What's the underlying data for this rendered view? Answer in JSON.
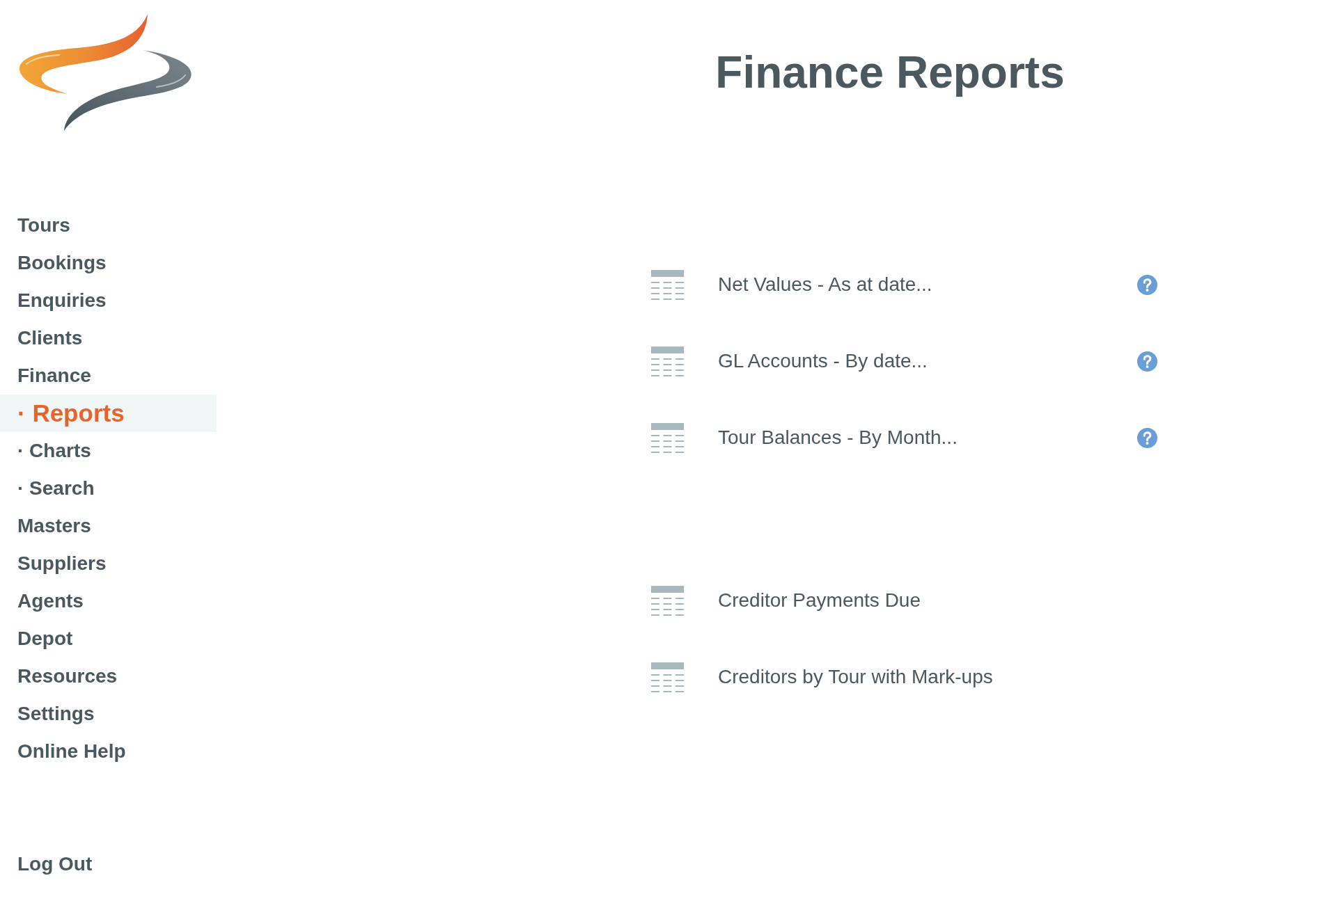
{
  "sidebar": {
    "items": [
      {
        "label": "Tours",
        "selected": false
      },
      {
        "label": "Bookings",
        "selected": false
      },
      {
        "label": "Enquiries",
        "selected": false
      },
      {
        "label": "Clients",
        "selected": false
      },
      {
        "label": "Finance",
        "selected": false
      },
      {
        "label": "· Reports",
        "selected": true
      },
      {
        "label": "· Charts",
        "selected": false
      },
      {
        "label": "· Search",
        "selected": false
      },
      {
        "label": "Masters",
        "selected": false
      },
      {
        "label": "Suppliers",
        "selected": false
      },
      {
        "label": "Agents",
        "selected": false
      },
      {
        "label": "Depot",
        "selected": false
      },
      {
        "label": "Resources",
        "selected": false
      },
      {
        "label": "Settings",
        "selected": false
      },
      {
        "label": "Online Help",
        "selected": false
      }
    ],
    "logout": "Log Out"
  },
  "main": {
    "title": "Finance Reports",
    "report_groups": [
      {
        "reports": [
          {
            "label": "Net Values - As at date...",
            "help": true
          },
          {
            "label": "GL Accounts - By date...",
            "help": true
          },
          {
            "label": "Tour Balances - By Month...",
            "help": true
          }
        ]
      },
      {
        "reports": [
          {
            "label": "Creditor Payments Due",
            "help": false
          },
          {
            "label": "Creditors by Tour with Mark-ups",
            "help": false
          }
        ]
      }
    ]
  }
}
